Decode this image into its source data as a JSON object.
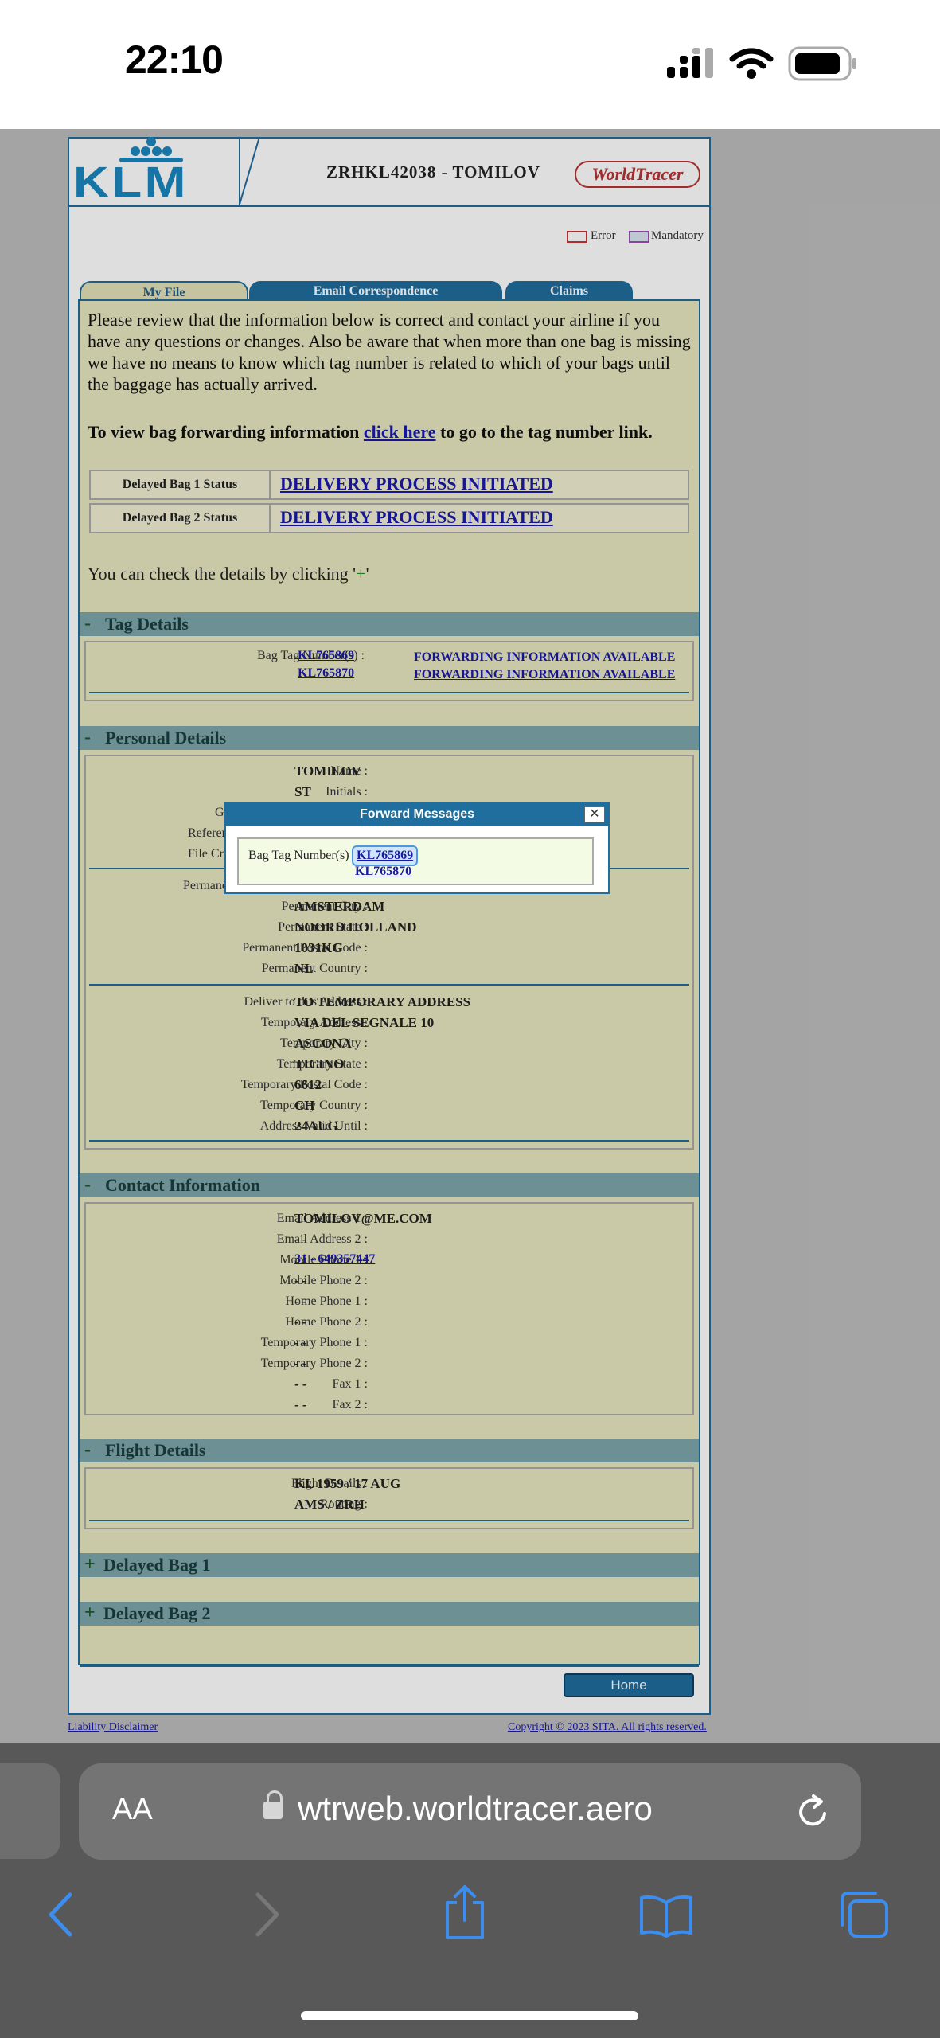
{
  "status_bar": {
    "time": "22:10"
  },
  "header": {
    "brand": "KLM",
    "file_title": "ZRHKL42038  -  TOMILOV",
    "worldtracer": "WorldTracer",
    "legend_error": "Error",
    "legend_mandatory": "Mandatory"
  },
  "tabs": {
    "my_file": "My File",
    "email": "Email Correspondence",
    "claims": "Claims"
  },
  "intro": "Please review that the information below is correct and contact your airline if you have any questions or changes. Also be aware that when more than one bag is missing we have no means to know which tag number is related to which of your bags until the baggage has actually arrived.",
  "bag_forward": {
    "pre": "To view bag forwarding information ",
    "link": "click here",
    "post": " to go to the tag number link."
  },
  "status": [
    {
      "label": "Delayed Bag 1 Status",
      "value": "DELIVERY PROCESS INITIATED"
    },
    {
      "label": "Delayed Bag 2 Status",
      "value": "DELIVERY PROCESS INITIATED"
    }
  ],
  "check_hint": {
    "text": "You can check the details by clicking '",
    "plus": "+",
    "end": "'"
  },
  "sections": {
    "tag": {
      "sym": "-",
      "title": "Tag Details"
    },
    "personal": {
      "sym": "-",
      "title": "Personal Details"
    },
    "contact": {
      "sym": "-",
      "title": "Contact Information"
    },
    "flight": {
      "sym": "-",
      "title": "Flight Details"
    },
    "bag1": {
      "sym": "+",
      "title": "Delayed Bag 1"
    },
    "bag2": {
      "sym": "+",
      "title": "Delayed Bag 2"
    }
  },
  "tag_details": {
    "label": "Bag Tag Number(s) :",
    "tags": [
      "KL765869",
      "KL765870"
    ],
    "fwd": [
      "FORWARDING INFORMATION AVAILABLE",
      "FORWARDING INFORMATION AVAILABLE"
    ]
  },
  "personal": {
    "name_l": "Name :",
    "name_v": "TOMILOV",
    "init_l": "Initials :",
    "init_v": "ST",
    "g_l": "G",
    "ref_l": "Referen",
    "fc_l": "File Cre",
    "perm_l": "Permane",
    "rows1": [
      {
        "l": "Permanent City :",
        "v": "AMSTERDAM"
      },
      {
        "l": "Permanent State :",
        "v": "NOORD HOLLAND"
      },
      {
        "l": "Permanent Postal Code :",
        "v": "1031KG"
      },
      {
        "l": "Permanent Country :",
        "v": "NL"
      }
    ],
    "rows2": [
      {
        "l": "Deliver to this Address :",
        "v": "TO TEMPORARY ADDRESS"
      },
      {
        "l": "Temporary Address :",
        "v": "VIA DEL SEGNALE 10"
      },
      {
        "l": "Temporary City :",
        "v": "ASCONA"
      },
      {
        "l": "Temporary State :",
        "v": "TICINO"
      },
      {
        "l": "Temporary Postal Code :",
        "v": "6612"
      },
      {
        "l": "Temporary Country :",
        "v": "CH"
      },
      {
        "l": "Address Valid Until :",
        "v": "24AUG"
      }
    ]
  },
  "contact": [
    {
      "l": "Email Address 1 :",
      "v": "TOMILOV@ME.COM"
    },
    {
      "l": "Email Address 2 :",
      "v": "- -"
    },
    {
      "l": "Mobile Phone 1 :",
      "v": "31 - 649357447"
    },
    {
      "l": "Mobile Phone 2 :",
      "v": "- -"
    },
    {
      "l": "Home Phone 1 :",
      "v": "- -"
    },
    {
      "l": "Home Phone 2 :",
      "v": "- -"
    },
    {
      "l": "Temporary Phone 1 :",
      "v": "- -"
    },
    {
      "l": "Temporary Phone 2 :",
      "v": "- -"
    },
    {
      "l": "Fax 1 :",
      "v": "- -"
    },
    {
      "l": "Fax 2 :",
      "v": "- -"
    }
  ],
  "flight": [
    {
      "l": "Flight Details :",
      "v": "KL 1959 / 17 AUG"
    },
    {
      "l": "Routing :",
      "v": "AMS  / ZRH"
    }
  ],
  "popup": {
    "title": "Forward Messages",
    "close": "✕",
    "label": "Bag Tag Number(s) :",
    "tags": [
      "KL765869",
      "KL765870"
    ]
  },
  "footer": {
    "home": "Home",
    "disclaimer": "Liability Disclaimer",
    "copyright": "Copyright © 2023 SITA. All rights reserved."
  },
  "browser": {
    "aa": "AA",
    "url": "wtrweb.worldtracer.aero"
  }
}
